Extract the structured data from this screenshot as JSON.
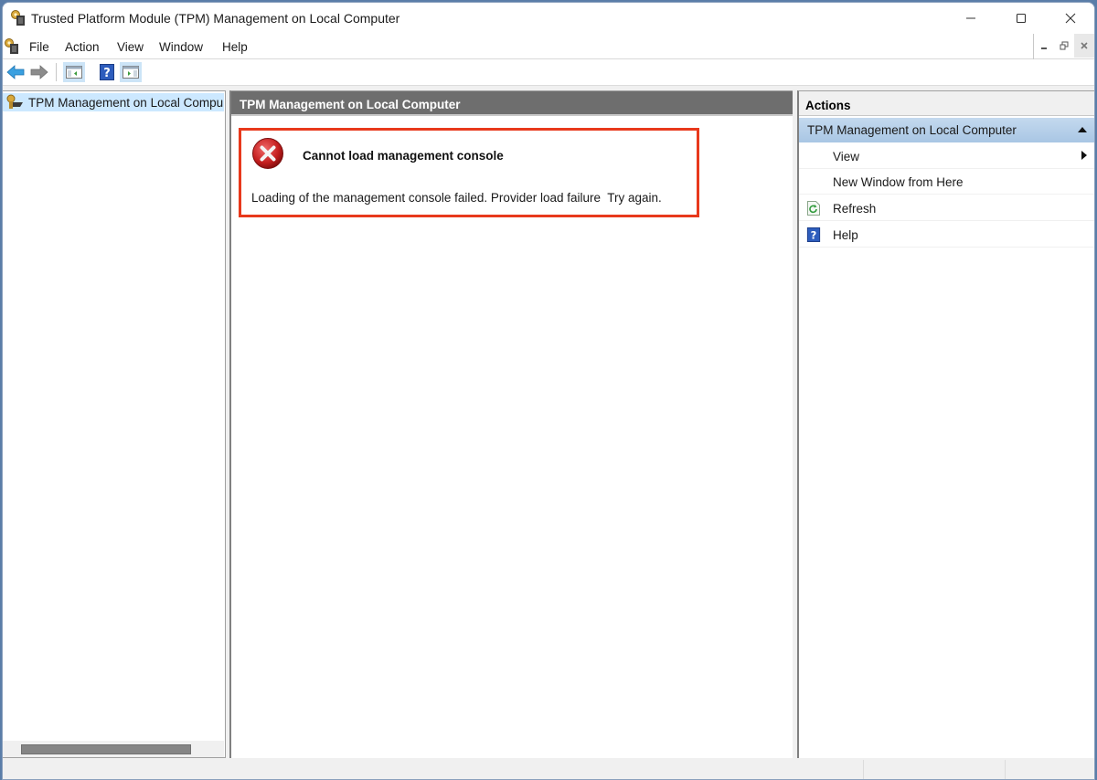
{
  "window": {
    "title": "Trusted Platform Module (TPM) Management on Local Computer",
    "controls": {
      "minimize": "minimize",
      "maximize": "maximize",
      "close": "close"
    }
  },
  "menubar": {
    "items": [
      {
        "label": "File"
      },
      {
        "label": "Action"
      },
      {
        "label": "View"
      },
      {
        "label": "Window"
      },
      {
        "label": "Help"
      }
    ]
  },
  "toolbar": {
    "buttons": [
      {
        "icon": "back-arrow-icon",
        "tooltip": "Back"
      },
      {
        "icon": "forward-arrow-icon",
        "tooltip": "Forward"
      },
      {
        "icon": "show-hide-console-tree-icon",
        "pressed": true
      },
      {
        "icon": "help-icon"
      },
      {
        "icon": "show-hide-action-pane-icon",
        "pressed": true
      }
    ]
  },
  "tree": {
    "items": [
      {
        "label": "TPM Management on Local Compu",
        "selected": true
      }
    ]
  },
  "center": {
    "header": "TPM Management on Local Computer",
    "error": {
      "title": "Cannot load management console",
      "message": "Loading of the management console failed. Provider load failure  Try again."
    }
  },
  "actions": {
    "header": "Actions",
    "section_title": "TPM Management on Local Computer",
    "items": [
      {
        "label": "View",
        "has_submenu": true
      },
      {
        "label": "New Window from Here"
      },
      {
        "label": "Refresh",
        "icon": "refresh-icon"
      },
      {
        "label": "Help",
        "icon": "help-icon"
      }
    ]
  },
  "colors": {
    "error_border": "#e8391c",
    "selection": "#cce8ff",
    "section_header": "#b5cfe9",
    "center_header": "#6e6e6e"
  }
}
